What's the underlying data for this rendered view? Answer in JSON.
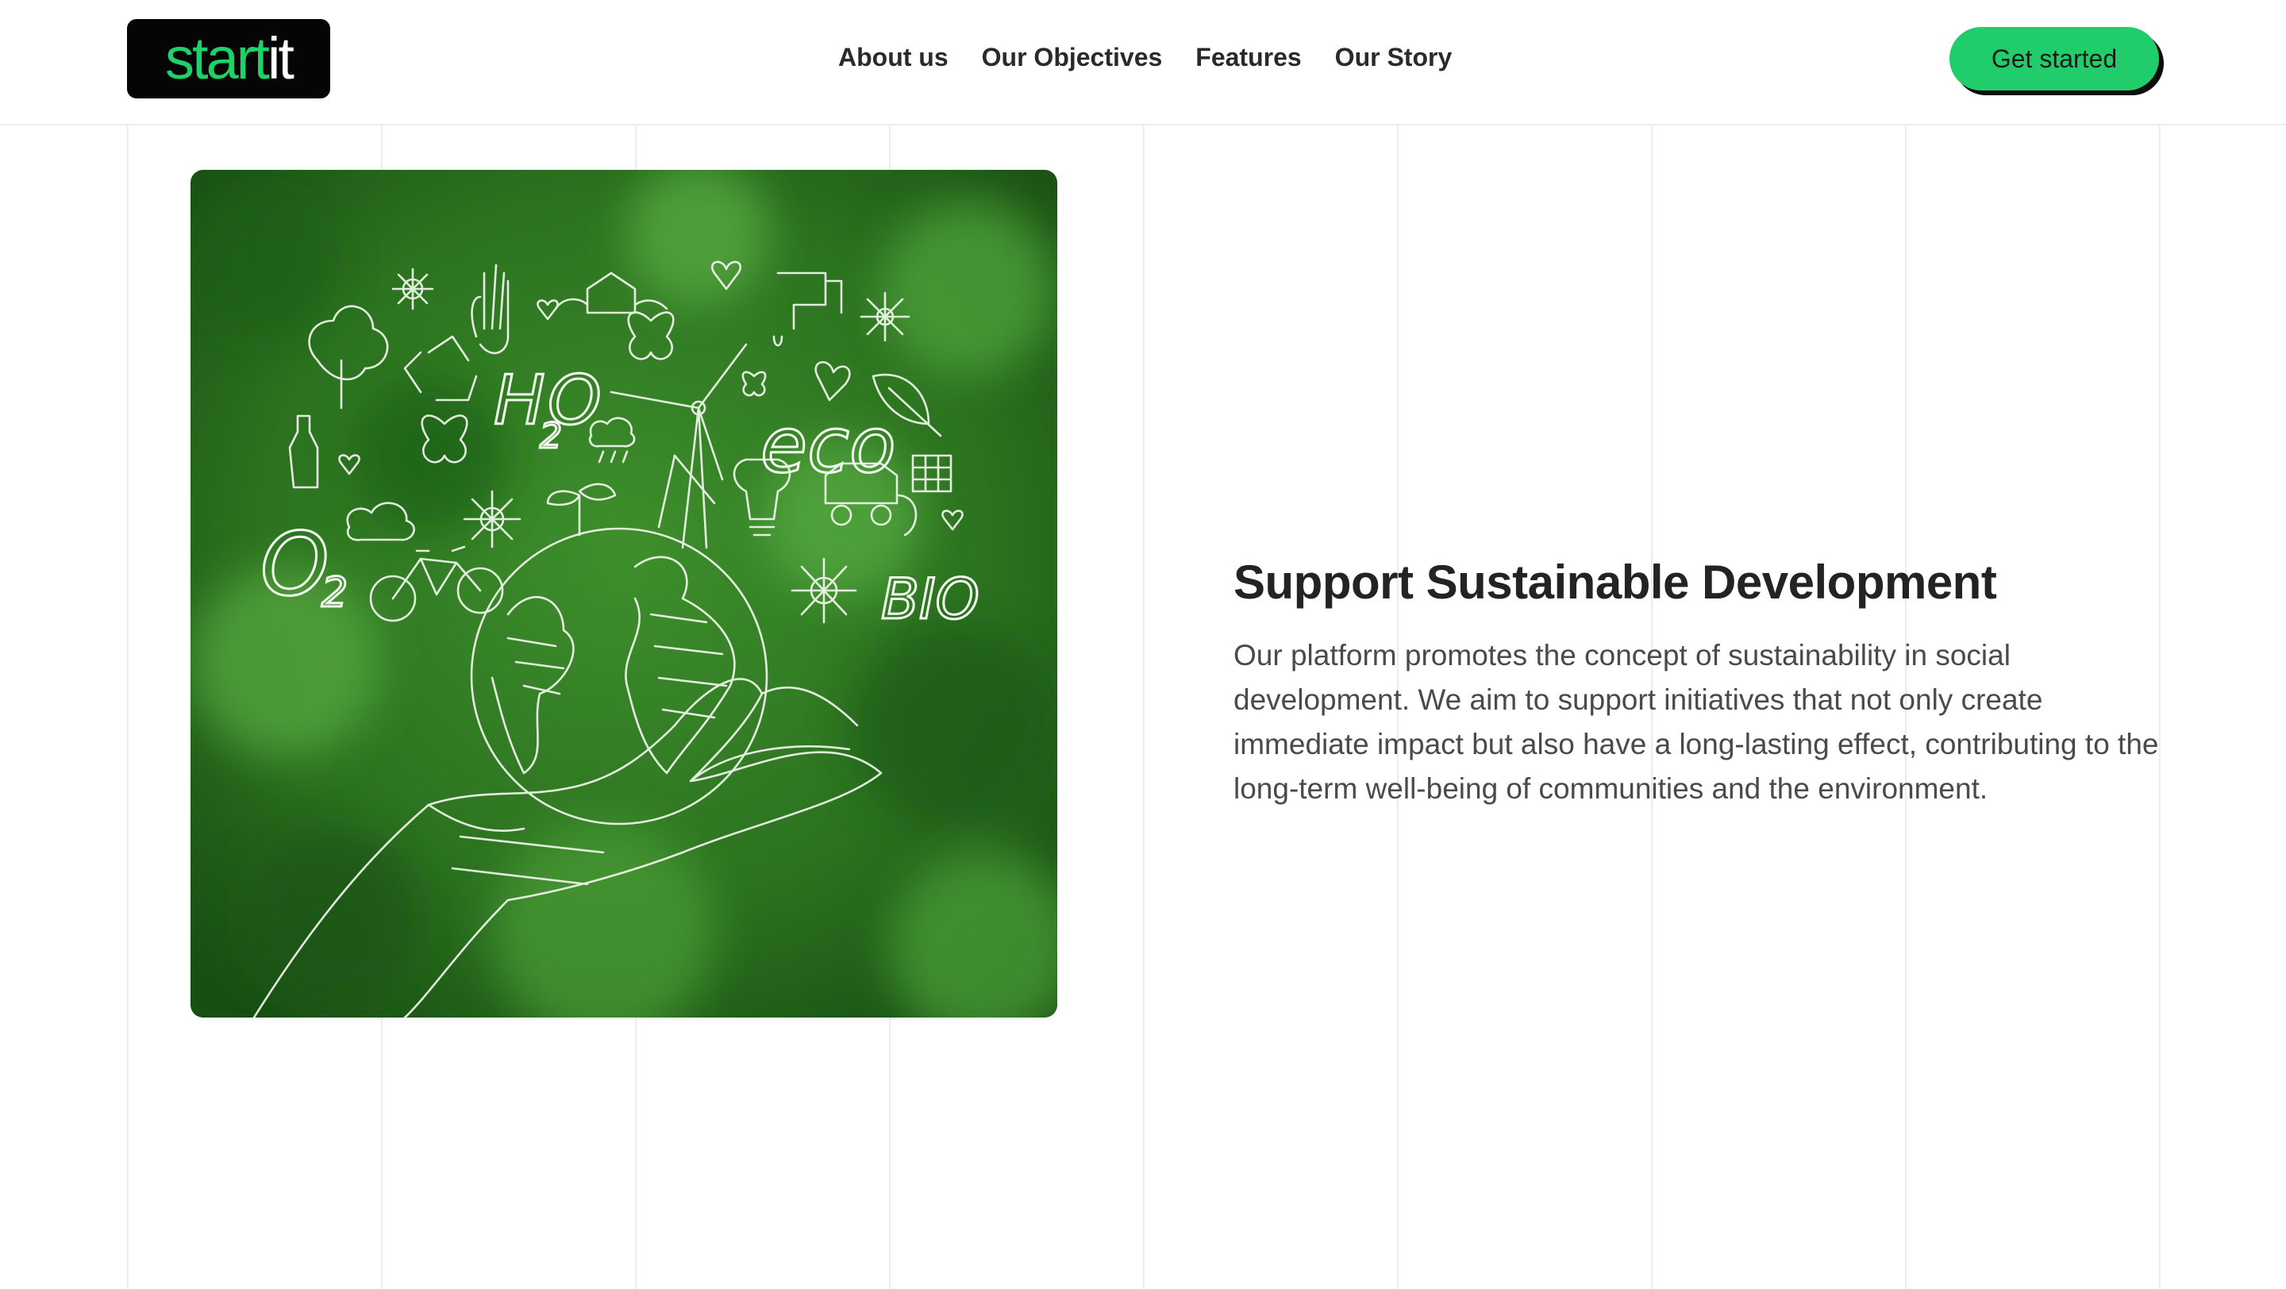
{
  "header": {
    "logo_part1": "start",
    "logo_part2": "it",
    "nav": [
      "About us",
      "Our Objectives",
      "Features",
      "Our Story"
    ],
    "cta_label": "Get started"
  },
  "hero": {
    "image_words": {
      "h": "H",
      "o": "O",
      "two": "2",
      "eco": "eco",
      "o2_o": "O",
      "o2_2": "2",
      "bio": "BIO"
    },
    "heading": "Support Sustainable Development",
    "paragraph": "Our platform promotes the concept of sustainability in social development. We aim to support initiatives that not only create immediate impact but also have a long-lasting effect, contributing to the long-term well-being of communities and the environment."
  },
  "colors": {
    "accent": "#21cc6b",
    "logo_bg": "#050505",
    "text": "#2a2a2a",
    "grid": "#ececec"
  }
}
